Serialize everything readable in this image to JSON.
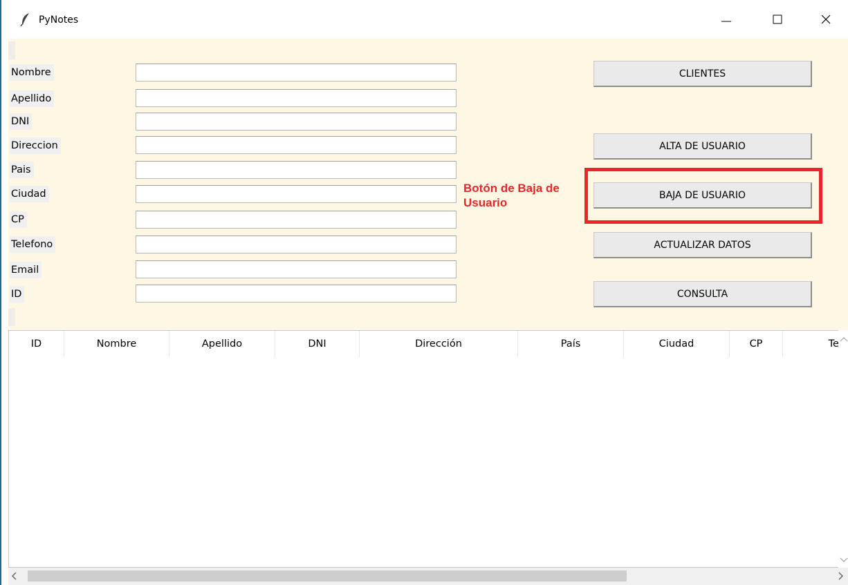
{
  "window": {
    "title": "PyNotes",
    "icon": "feather-icon"
  },
  "form": {
    "fields": [
      {
        "label": "Nombre",
        "value": ""
      },
      {
        "label": "Apellido",
        "value": ""
      },
      {
        "label": "DNI",
        "value": ""
      },
      {
        "label": "Direccion",
        "value": ""
      },
      {
        "label": "Pais",
        "value": ""
      },
      {
        "label": "Ciudad",
        "value": ""
      },
      {
        "label": "CP",
        "value": ""
      },
      {
        "label": "Telefono",
        "value": ""
      },
      {
        "label": "Email",
        "value": ""
      },
      {
        "label": "ID",
        "value": ""
      }
    ]
  },
  "buttons": {
    "clientes": "CLIENTES",
    "alta": "ALTA DE USUARIO",
    "baja": "BAJA DE USUARIO",
    "actualizar": "ACTUALIZAR DATOS",
    "consulta": "CONSULTA"
  },
  "annotation": {
    "text": "Botón de Baja de Usuario",
    "color": "#e8262b"
  },
  "table": {
    "columns": [
      "ID",
      "Nombre",
      "Apellido",
      "DNI",
      "Dirección",
      "País",
      "Ciudad",
      "CP",
      "Tel"
    ],
    "rows": []
  },
  "colors": {
    "form_background": "#fdf7e3",
    "highlight": "#e8262b"
  }
}
